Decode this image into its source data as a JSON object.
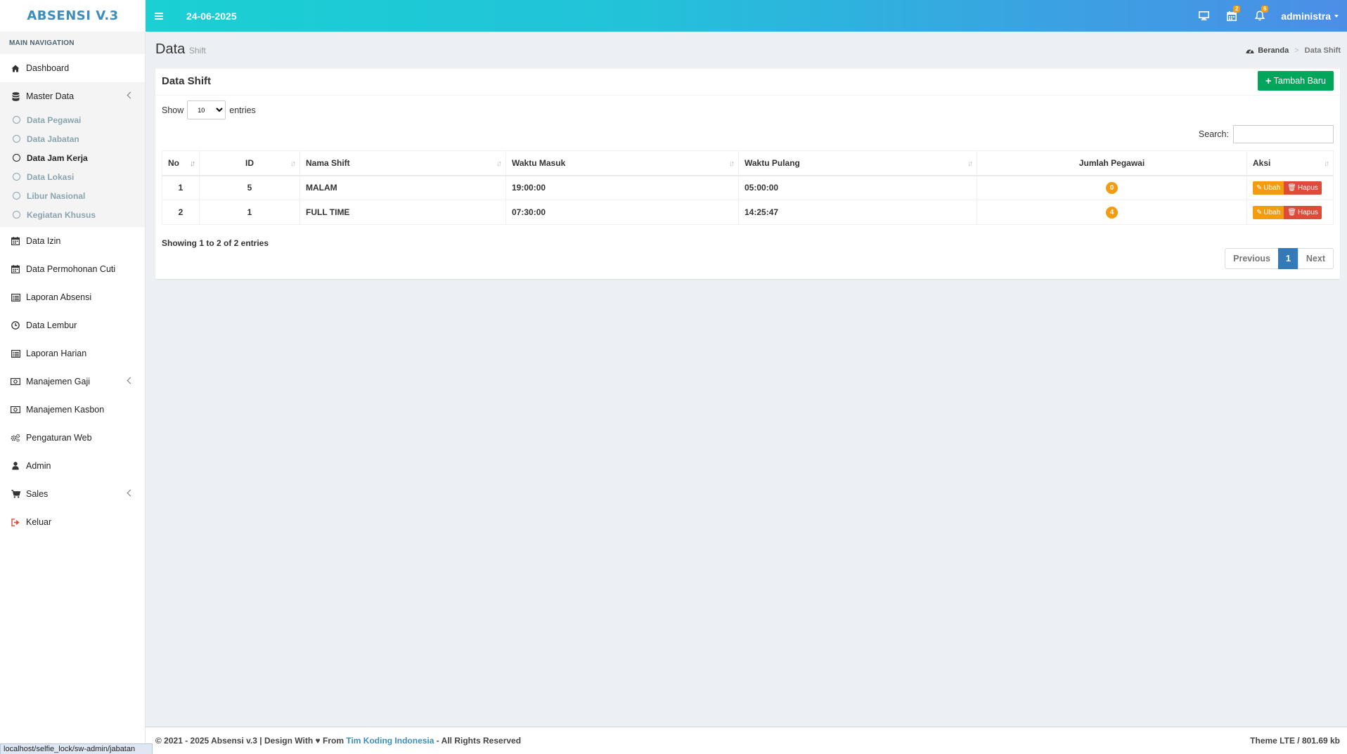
{
  "app": {
    "logo": "ABSENSI V.3"
  },
  "navbar": {
    "date": "24-06-2025",
    "calendar_badge": "2",
    "bell_badge": "6",
    "user": "administra"
  },
  "sidebar": {
    "header": "MAIN NAVIGATION",
    "dashboard": "Dashboard",
    "master_data": "Master Data",
    "sub": [
      "Data Pegawai",
      "Data Jabatan",
      "Data Jam Kerja",
      "Data Lokasi",
      "Libur Nasional",
      "Kegiatan Khusus"
    ],
    "items": [
      "Data Izin",
      "Data Permohonan Cuti",
      "Laporan Absensi",
      "Data Lembur",
      "Laporan Harian",
      "Manajemen Gaji",
      "Manajemen Kasbon",
      "Pengaturan Web",
      "Admin",
      "Sales",
      "Keluar"
    ]
  },
  "page": {
    "title": "Data",
    "subtitle": "Shift"
  },
  "breadcrumb": {
    "home": "Beranda",
    "sep": ">",
    "current": "Data Shift"
  },
  "box": {
    "title": "Data Shift",
    "add_button": "Tambah Baru"
  },
  "table": {
    "show_label": "Show",
    "entries_label": "entries",
    "length_value": "10",
    "search_label": "Search:",
    "columns": [
      "No",
      "ID",
      "Nama Shift",
      "Waktu Masuk",
      "Waktu Pulang",
      "Jumlah Pegawai",
      "Aksi"
    ],
    "rows": [
      {
        "no": "1",
        "id": "5",
        "nama": "MALAM",
        "masuk": "19:00:00",
        "pulang": "05:00:00",
        "jumlah": "0"
      },
      {
        "no": "2",
        "id": "1",
        "nama": "FULL TIME",
        "masuk": "07:30:00",
        "pulang": "14:25:47",
        "jumlah": "4"
      }
    ],
    "edit_label": "Ubah",
    "delete_label": "Hapus",
    "info": "Showing 1 to 2 of 2 entries",
    "pager": {
      "prev": "Previous",
      "current": "1",
      "next": "Next"
    }
  },
  "footer": {
    "left_prefix": "© 2021 - 2025 Absensi v.3 | Design With",
    "from": "From",
    "link": "Tim Koding Indonesia",
    "left_suffix": "- All Rights Reserved",
    "right": "Theme LTE / 801.69 kb"
  },
  "statusbar": {
    "url": "localhost/selfie_lock/sw-admin/jabatan"
  },
  "colors": {
    "accent": "#3c8dbc",
    "success": "#00a65a",
    "warning": "#f39c12",
    "danger": "#dd4b39",
    "primary": "#337ab7"
  }
}
